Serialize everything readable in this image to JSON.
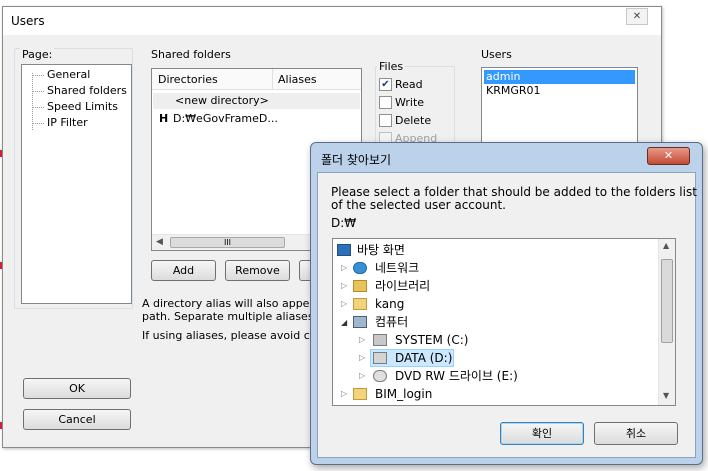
{
  "users_window": {
    "title": "Users",
    "close_glyph": "✕",
    "page": {
      "label": "Page:",
      "items": [
        "General",
        "Shared folders",
        "Speed Limits",
        "IP Filter"
      ]
    },
    "shared_folders": {
      "label": "Shared folders",
      "columns": [
        "Directories",
        "Aliases"
      ],
      "rows": [
        {
          "marker": "",
          "directory": "<new directory>"
        },
        {
          "marker": "H",
          "directory": "D:₩eGovFrameD..."
        }
      ],
      "scroll_thumb": "III",
      "buttons": [
        "Add",
        "Remove"
      ]
    },
    "files": {
      "label": "Files",
      "options": [
        {
          "label": "Read",
          "checked": true,
          "enabled": true
        },
        {
          "label": "Write",
          "checked": false,
          "enabled": true
        },
        {
          "label": "Delete",
          "checked": false,
          "enabled": true
        },
        {
          "label": "Append",
          "checked": false,
          "enabled": false
        }
      ]
    },
    "users": {
      "label": "Users",
      "items": [
        "admin",
        "KRMGR01"
      ],
      "selected": "admin"
    },
    "hint_lines": [
      "A directory alias will also appear at th",
      "path. Separate multiple aliases for on",
      "If using aliases, please avoid cyclic"
    ],
    "ok_label": "OK",
    "cancel_label": "Cancel"
  },
  "folder_dialog": {
    "title": "폴더 찾아보기",
    "close_glyph": "✕",
    "instruction": [
      "Please select a folder that should be added to the folders list",
      "of the selected user account."
    ],
    "path": "D:₩",
    "tree": [
      {
        "label": "바탕 화면",
        "icon": "desktop-icon",
        "expander": ""
      },
      {
        "label": "네트워크",
        "icon": "network-icon",
        "expander": "▷"
      },
      {
        "label": "라이브러리",
        "icon": "library-icon",
        "expander": "▷"
      },
      {
        "label": "kang",
        "icon": "user-folder-icon",
        "expander": "▷"
      },
      {
        "label": "컴퓨터",
        "icon": "computer-icon",
        "expander": "◢"
      },
      {
        "label": "SYSTEM (C:)",
        "icon": "system-drive-icon",
        "expander": "▷"
      },
      {
        "label": "DATA (D:)",
        "icon": "drive-icon",
        "expander": "▷"
      },
      {
        "label": "DVD RW 드라이브 (E:)",
        "icon": "dvd-drive-icon",
        "expander": "▷"
      },
      {
        "label": "BIM_login",
        "icon": "folder-icon",
        "expander": "▷"
      }
    ],
    "selected": "DATA (D:)",
    "ok_label": "확인",
    "cancel_label": "취소",
    "colors": {
      "selection": "#cce8ff",
      "title_bar": "#bcd2ea",
      "close_button": "#c24a33"
    }
  }
}
